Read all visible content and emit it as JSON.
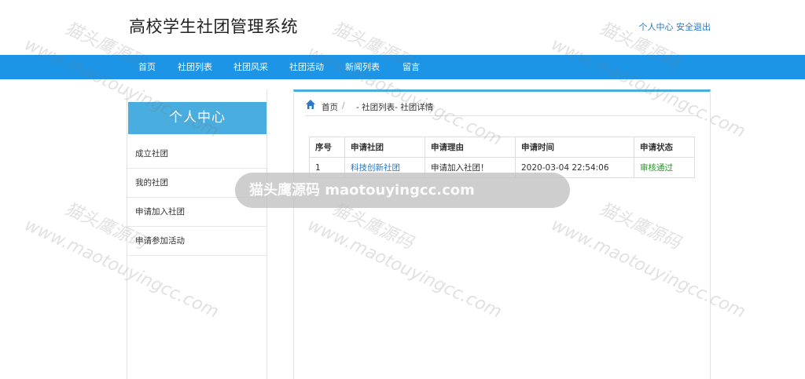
{
  "header": {
    "title": "高校学生社团管理系统",
    "user_center": "个人中心",
    "logout": "安全退出"
  },
  "nav": [
    "首页",
    "社团列表",
    "社团风采",
    "社团活动",
    "新闻列表",
    "留言"
  ],
  "sidebar": {
    "title": "个人中心",
    "items": [
      "成立社团",
      "我的社团",
      "申请加入社团",
      "申请参加活动"
    ]
  },
  "breadcrumb": {
    "home": "首页",
    "sep": "/",
    "path": "- 社团列表- 社团详情"
  },
  "table": {
    "headers": [
      "序号",
      "申请社团",
      "申请理由",
      "申请时间",
      "申请状态"
    ],
    "rows": [
      {
        "no": "1",
        "club": "科技创新社团",
        "reason": "申请加入社团！",
        "time": "2020-03-04 22:54:06",
        "status": "审核通过"
      }
    ]
  },
  "watermark": {
    "cn": "猫头鹰源码",
    "en": "www.maotouyingcc.com",
    "bar": "猫头鹰源码 maotouyingcc.com"
  },
  "colors": {
    "nav_bg": "#1c95e7",
    "accent": "#4aaddf",
    "link": "#2b78c5",
    "status_ok": "#2a9a2a"
  }
}
